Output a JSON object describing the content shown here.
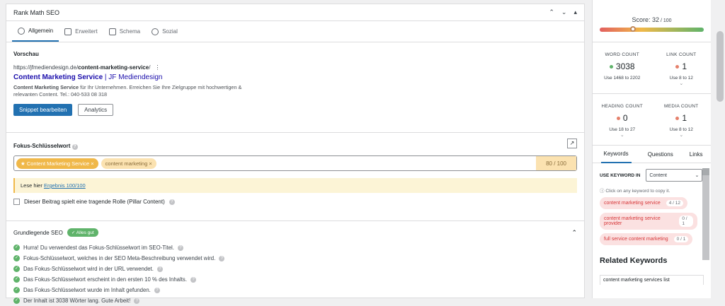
{
  "panel": {
    "title": "Rank Math SEO",
    "tabs": [
      "Allgemein",
      "Erweitert",
      "Schema",
      "Sozial"
    ],
    "preview_label": "Vorschau",
    "url_prefix": "https://jfmediendesign.de/",
    "url_slug": "content-marketing-service",
    "url_suffix": "/",
    "title_bold": "Content Marketing Service",
    "title_rest": " | JF Mediendesign",
    "desc_bold": "Content Marketing Service",
    "desc_rest": " für Ihr Unternehmen. Erreichen Sie Ihre Zielgruppe mit hochwertigen & relevanten Content. Tel.: 040-533 08 318",
    "edit_snippet": "Snippet bearbeiten",
    "analytics": "Analytics",
    "focus_label": "Fokus-Schlüsselwort",
    "focus_chip": "Content Marketing Service",
    "focus_chip2": "content marketing",
    "focus_score": "80 / 100",
    "notice_text": "Lese hier ",
    "notice_link": "Ergebnis 100/100",
    "pillar_label": "Dieser Beitrag spielt eine tragende Rolle (Pillar Content)",
    "basic_seo": "Grundlegende SEO",
    "basic_badge": "Alles gut",
    "checks": [
      "Hurra! Du verwendest das Fokus-Schlüsselwort im SEO-Titel.",
      "Fokus-Schlüsselwort, welches in der SEO Meta-Beschreibung verwendet wird.",
      "Das Fokus-Schlüsselwort wird in der URL verwendet.",
      "Das Fokus-Schlüsselwort erscheint in den ersten 10 % des Inhalts.",
      "Das Fokus-Schlüsselwort wurde im Inhalt gefunden.",
      "Der Inhalt ist 3038 Wörter lang. Gute Arbeit!"
    ]
  },
  "sidebar": {
    "score_label": "Score: 32",
    "score_max": " / 100",
    "score_fraction": 0.32,
    "word_count_label": "WORD COUNT",
    "word_count": "3038",
    "word_use": "Use 1468 to 2202",
    "link_count_label": "LINK COUNT",
    "link_count": "1",
    "link_use": "Use 8 to 12",
    "heading_count_label": "HEADING COUNT",
    "heading_count": "0",
    "heading_use": "Use 18 to 27",
    "media_count_label": "MEDIA COUNT",
    "media_count": "1",
    "media_use": "Use 8 to 12",
    "tabs": [
      "Keywords",
      "Questions",
      "Links"
    ],
    "use_keyword_in": "USE KEYWORD IN",
    "use_keyword_value": "Content",
    "hint": "Click on any keyword to copy it.",
    "keywords": [
      {
        "text": "content marketing service",
        "count": "4 / 12"
      },
      {
        "text": "content marketing service provider",
        "count": "0 / 1"
      },
      {
        "text": "full service content marketing",
        "count": "0 / 1"
      }
    ],
    "related_title": "Related Keywords",
    "related_first": "content marketing services list"
  },
  "colors": {
    "accent": "#2271b1",
    "good": "#5fb36a",
    "warn": "#f0b849",
    "bad": "#d63638"
  }
}
